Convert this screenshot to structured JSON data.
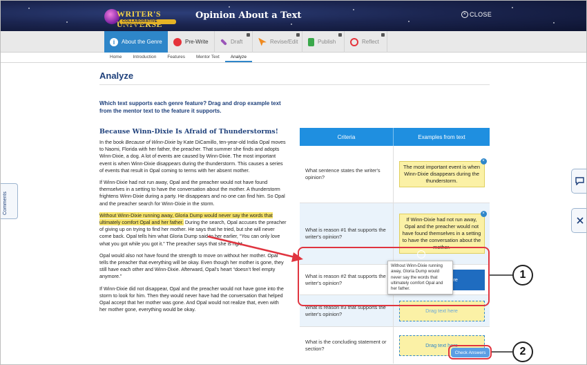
{
  "header": {
    "logo_main": "WRITER'S UNIVERSE",
    "logo_sub": "COLLABORATIVE WORKSHOP",
    "title": "Opinion About a Text",
    "close_label": "CLOSE"
  },
  "steps": [
    {
      "label": "About the Genre",
      "icon": "info-icon",
      "locked": false,
      "active": true
    },
    {
      "label": "Pre-Write",
      "icon": "lightbulb-icon",
      "locked": false,
      "active": false
    },
    {
      "label": "Draft",
      "icon": "pencil-icon",
      "locked": true,
      "active": false
    },
    {
      "label": "Revise/Edit",
      "icon": "cursor-icon",
      "locked": true,
      "active": false
    },
    {
      "label": "Publish",
      "icon": "publish-icon",
      "locked": true,
      "active": false
    },
    {
      "label": "Reflect",
      "icon": "reflect-icon",
      "locked": true,
      "active": false
    }
  ],
  "subnav": [
    "Home",
    "Introduction",
    "Features",
    "Mentor Text",
    "Analyze"
  ],
  "subnav_active": "Analyze",
  "page": {
    "heading": "Analyze",
    "instructions": "Which text supports each genre feature? Drag and drop example text from the mentor text to the feature it supports."
  },
  "story": {
    "title": "Because Winn-Dixie Is Afraid of Thunderstorms!",
    "p1_pre": "In the book ",
    "p1_book": "Because of Winn-Dixie",
    "p1_post": " by Kate DiCamillo, ten-year-old India Opal moves to Naomi, Florida with her father, the preacher. That summer she finds and adopts Winn-Dixie, a dog. A lot of events are caused by Winn-Dixie. The most important event is when Winn-Dixie disappears during the thunderstorm. This causes a series of events that result in Opal coming to terms with her absent mother.",
    "p2": "If Winn-Dixie had not run away, Opal and the preacher would not have found themselves in a setting to have the conversation about the mother. A thunderstorm frightens Winn-Dixie during a party. He disappears and no one can find him. So Opal and the preacher search for Winn-Dixie in the storm.",
    "p3_highlight": "Without Winn-Dixie running away, Gloria Dump would never say the words that ultimately comfort Opal and her father.",
    "p3_rest": " During the search, Opal accuses the preacher of giving up on trying to find her mother. He says that he tried, but she will never come back. Opal tells him what Gloria Dump said to her earlier, “You can only love what you got while you got it.” The preacher says that she is right.",
    "p4": "Opal would also not have found the strength to move on without her mother. Opal tells the preacher that everything will be okay. Even though her mother is gone, they still have each other and Winn-Dixie. Afterward, Opal’s heart “doesn’t feel empty anymore.”",
    "p5": "If Winn-Dixie did not disappear, Opal and the preacher would not have gone into the storm to look for him. Then they would never have had the conversation that helped Opal accept that her mother was gone. And Opal would not realize that, even with her mother gone, everything would be okay."
  },
  "table": {
    "col1": "Criteria",
    "col2": "Examples from text",
    "drop_placeholder": "Drag text here",
    "rows": [
      {
        "criteria": "What sentence states the writer's opinion?",
        "example": "The most important event is when Winn-Dixie disappears during the thunderstorm."
      },
      {
        "criteria": "What is reason #1 that supports the writer's opinion?",
        "example": "If Winn-Dixie had not run away, Opal and the preacher would not have found themselves in a setting to have the conversation about the mother."
      },
      {
        "criteria": "What is reason #2 that supports the writer's opinion?",
        "example": ""
      },
      {
        "criteria": "What is reason #3 that supports the writer's opinion?",
        "example": ""
      },
      {
        "criteria": "What is the concluding statement or section?",
        "example": ""
      }
    ]
  },
  "dragging_text": "Without Winn-Dixie running away, Gloria Dump would never say the words that ultimately comfort Opal and her father.",
  "check_answers_label": "Check Answers",
  "side": {
    "comments_label": "Comments"
  },
  "callouts": [
    "1",
    "2"
  ],
  "colors": {
    "accent": "#1f8fe0",
    "annotation": "#e0343f",
    "highlight": "#f7e46a"
  }
}
